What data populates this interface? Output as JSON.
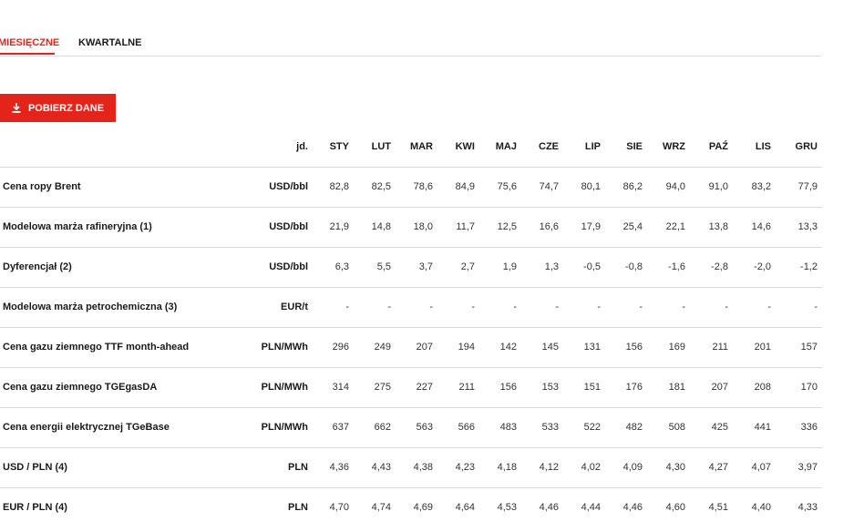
{
  "tabs": [
    {
      "label": "MIESIĘCZNE",
      "active": true
    },
    {
      "label": "KWARTALNE",
      "active": false
    }
  ],
  "download_button": {
    "label": "POBIERZ DANE",
    "icon": "download-icon"
  },
  "colors": {
    "accent": "#e3241b",
    "divider": "#d9d9d9",
    "text": "#1a1a1a"
  },
  "table": {
    "unit_header": "jd.",
    "months": [
      "STY",
      "LUT",
      "MAR",
      "KWI",
      "MAJ",
      "CZE",
      "LIP",
      "SIE",
      "WRZ",
      "PAŹ",
      "LIS",
      "GRU"
    ],
    "rows": [
      {
        "label": "Cena ropy Brent",
        "unit": "USD/bbl",
        "values": [
          "82,8",
          "82,5",
          "78,6",
          "84,9",
          "75,6",
          "74,7",
          "80,1",
          "86,2",
          "94,0",
          "91,0",
          "83,2",
          "77,9"
        ]
      },
      {
        "label": "Modelowa marża rafineryjna (1)",
        "unit": "USD/bbl",
        "values": [
          "21,9",
          "14,8",
          "18,0",
          "11,7",
          "12,5",
          "16,6",
          "17,9",
          "25,4",
          "22,1",
          "13,8",
          "14,6",
          "13,3"
        ]
      },
      {
        "label": "Dyferencjał (2)",
        "unit": "USD/bbl",
        "values": [
          "6,3",
          "5,5",
          "3,7",
          "2,7",
          "1,9",
          "1,3",
          "-0,5",
          "-0,8",
          "-1,6",
          "-2,8",
          "-2,0",
          "-1,2"
        ]
      },
      {
        "label": "Modelowa marża petrochemiczna (3)",
        "unit": "EUR/t",
        "values": [
          "-",
          "-",
          "-",
          "-",
          "-",
          "-",
          "-",
          "-",
          "-",
          "-",
          "-",
          "-"
        ]
      },
      {
        "label": "Cena gazu ziemnego TTF month-ahead",
        "unit": "PLN/MWh",
        "values": [
          "296",
          "249",
          "207",
          "194",
          "142",
          "145",
          "131",
          "156",
          "169",
          "211",
          "201",
          "157"
        ]
      },
      {
        "label": "Cena gazu ziemnego TGEgasDA",
        "unit": "PLN/MWh",
        "values": [
          "314",
          "275",
          "227",
          "211",
          "156",
          "153",
          "151",
          "176",
          "181",
          "207",
          "208",
          "170"
        ]
      },
      {
        "label": "Cena energii elektrycznej TGeBase",
        "unit": "PLN/MWh",
        "values": [
          "637",
          "662",
          "563",
          "566",
          "483",
          "533",
          "522",
          "482",
          "508",
          "425",
          "441",
          "336"
        ]
      },
      {
        "label": "USD / PLN (4)",
        "unit": "PLN",
        "values": [
          "4,36",
          "4,43",
          "4,38",
          "4,23",
          "4,18",
          "4,12",
          "4,02",
          "4,09",
          "4,30",
          "4,27",
          "4,07",
          "3,97"
        ]
      },
      {
        "label": "EUR / PLN (4)",
        "unit": "PLN",
        "values": [
          "4,70",
          "4,74",
          "4,69",
          "4,64",
          "4,53",
          "4,46",
          "4,44",
          "4,46",
          "4,60",
          "4,51",
          "4,40",
          "4,33"
        ]
      }
    ]
  }
}
